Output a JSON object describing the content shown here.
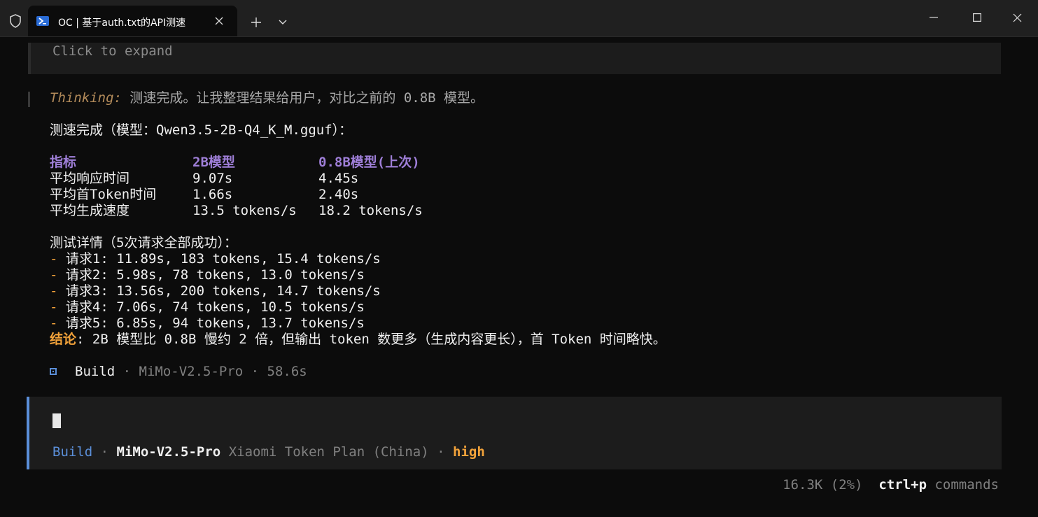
{
  "window": {
    "tab_title": "OC | 基于auth.txt的API测速",
    "tab_icon": "powershell-icon",
    "colors": {
      "accent": "#5b8fd9",
      "orange": "#f2a23a",
      "purple": "#9f7fd8",
      "thinking": "#b38b5a"
    }
  },
  "terminal": {
    "collapsed_hint": "Click to expand",
    "thinking_label": "Thinking:",
    "thinking_text": " 测速完成。让我整理结果给用户，对比之前的 0.8B 模型。",
    "summary_line": "测速完成（模型：Qwen3.5-2B-Q4_K_M.gguf）：",
    "table": {
      "headers": [
        "指标",
        "2B模型",
        "0.8B模型(上次)"
      ],
      "rows": [
        [
          "平均响应时间",
          "9.07s",
          "4.45s"
        ],
        [
          "平均首Token时间",
          "1.66s",
          "2.40s"
        ],
        [
          "平均生成速度",
          "13.5 tokens/s",
          "18.2 tokens/s"
        ]
      ]
    },
    "details_title": "测试详情（5次请求全部成功）：",
    "dash": "-",
    "details": [
      " 请求1: 11.89s, 183 tokens, 15.4 tokens/s",
      " 请求2: 5.98s, 78 tokens, 13.0 tokens/s",
      " 请求3: 13.56s, 200 tokens, 14.7 tokens/s",
      " 请求4: 7.06s, 74 tokens, 10.5 tokens/s",
      " 请求5: 6.85s, 94 tokens, 13.7 tokens/s"
    ],
    "conclusion_label": "结论",
    "conclusion_text": ": 2B 模型比 0.8B 慢约 2 倍，但输出 token 数更多（生成内容更长），首 Token 时间略快。",
    "build_label": "Build",
    "build_meta": " · MiMo-V2.5-Pro · 58.6s"
  },
  "input": {
    "agent": "Build",
    "sep1": " · ",
    "model": "MiMo-V2.5-Pro",
    "provider": " Xiaomi Token Plan (China)",
    "sep2": " · ",
    "effort": "high"
  },
  "footer": {
    "usage": "16.3K (2%)",
    "shortcut": "ctrl+p",
    "shortcut_label": " commands"
  }
}
